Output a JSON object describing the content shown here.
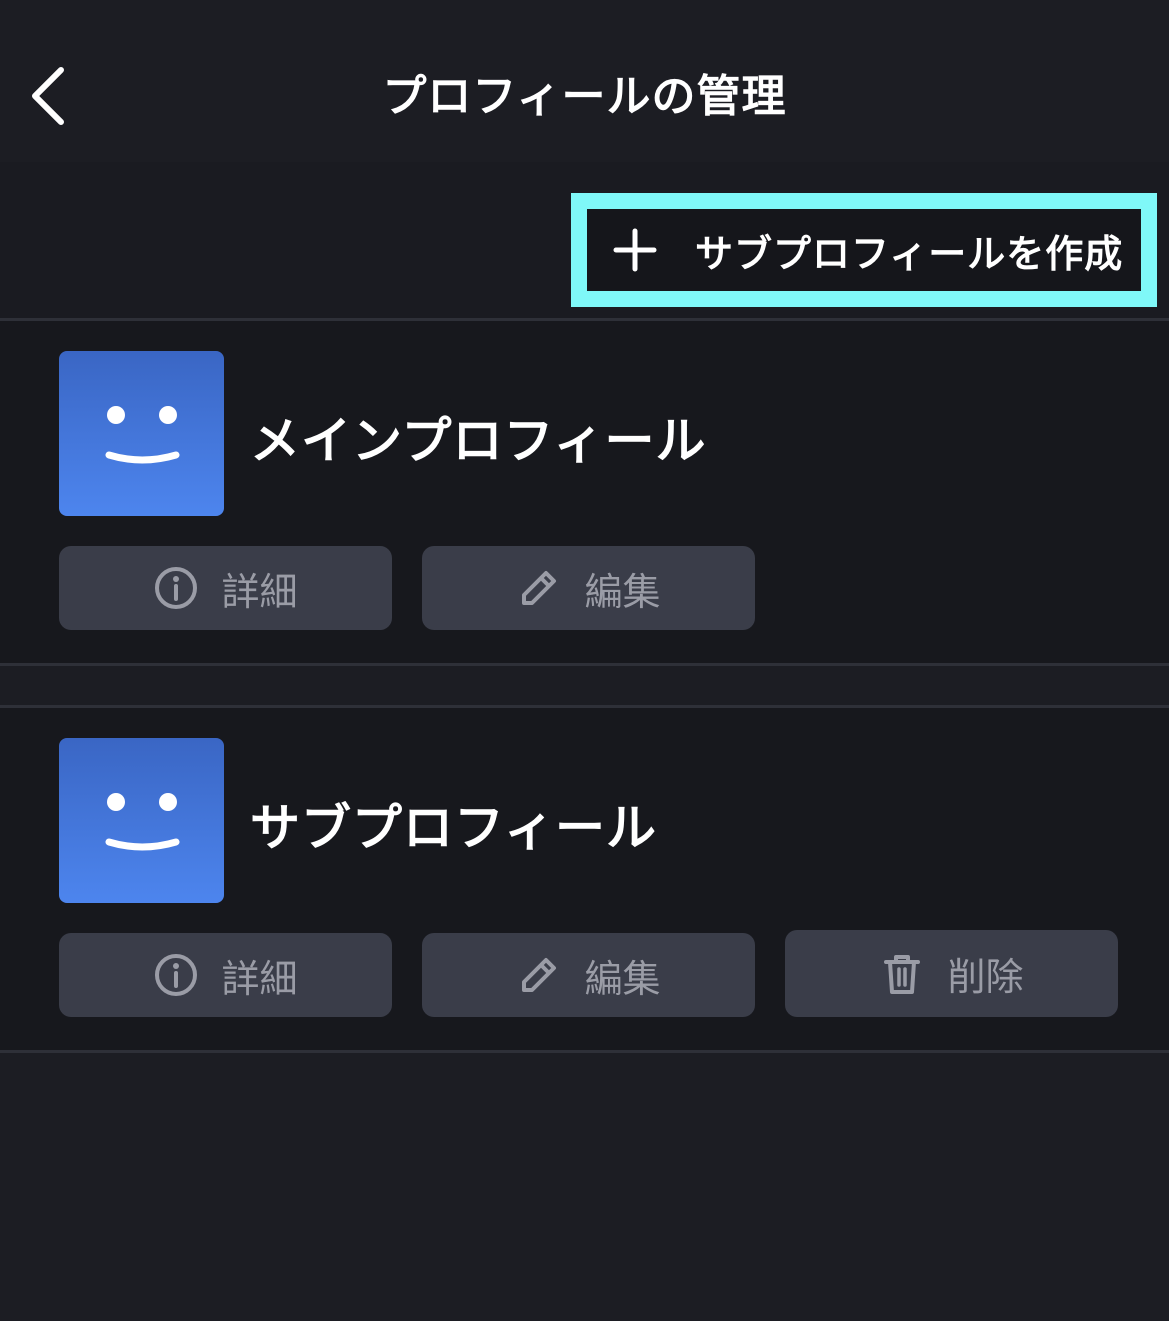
{
  "header": {
    "title": "プロフィールの管理",
    "back_icon": "chevron-left-icon"
  },
  "toolbar": {
    "create_label": "サブプロフィールを作成",
    "create_icon": "plus-icon",
    "highlight_color": "#7ff8f8"
  },
  "profiles": [
    {
      "name": "メインプロフィール",
      "avatar_icon": "smiley-face-icon",
      "actions": [
        {
          "label": "詳細",
          "icon": "info-icon"
        },
        {
          "label": "編集",
          "icon": "pencil-icon"
        }
      ]
    },
    {
      "name": "サブプロフィール",
      "avatar_icon": "smiley-face-icon",
      "actions": [
        {
          "label": "詳細",
          "icon": "info-icon"
        },
        {
          "label": "編集",
          "icon": "pencil-icon"
        },
        {
          "label": "削除",
          "icon": "trash-icon"
        }
      ]
    }
  ],
  "colors": {
    "background": "#1c1d23",
    "card": "#17181d",
    "button": "#3a3d49",
    "button_text": "#9a9ca6",
    "avatar_top": "#3a66c4",
    "avatar_bottom": "#4d85ee"
  }
}
